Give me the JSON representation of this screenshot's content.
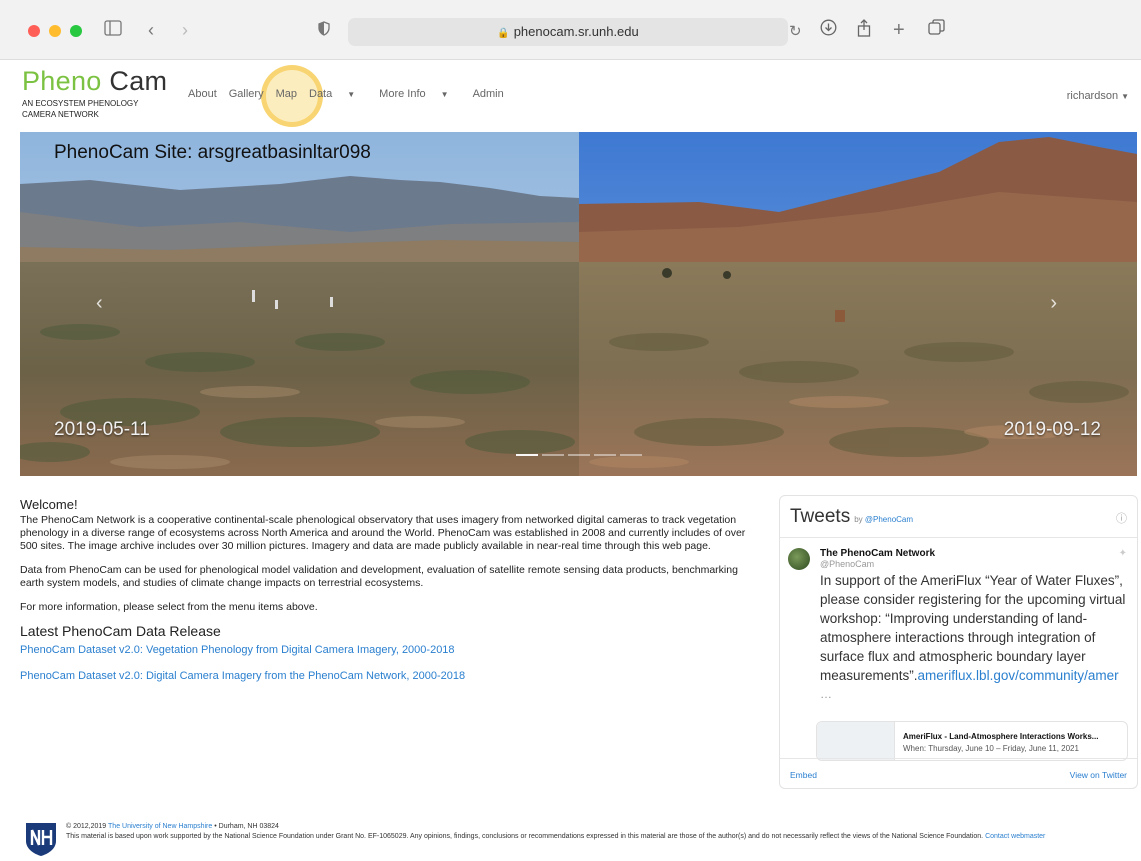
{
  "browser": {
    "url": "phenocam.sr.unh.edu"
  },
  "site": {
    "logo_pheno": "Pheno",
    "logo_cam": "Cam",
    "logo_subtitle": "AN ECOSYSTEM PHENOLOGY CAMERA NETWORK",
    "nav": {
      "about": "About",
      "gallery": "Gallery",
      "map": "Map",
      "data": "Data",
      "more_info": "More Info",
      "admin": "Admin"
    },
    "user": "richardson"
  },
  "hero": {
    "title": "PhenoCam Site: arsgreatbasinltar098",
    "date_left": "2019-05-11",
    "date_right": "2019-09-12",
    "indicator_count": 5,
    "active_indicator": 1
  },
  "welcome": {
    "heading": "Welcome!",
    "p1": "The PhenoCam Network is a cooperative continental-scale phenological observatory that uses imagery from networked digital cameras to track vegetation phenology in a diverse range of ecosystems across North America and around the World. PhenoCam was established in 2008 and currently includes of over 500 sites. The image archive includes over 30 million pictures. Imagery and data are made publicly available in near-real time through this web page.",
    "p2": "Data from PhenoCam can be used for phenological model validation and development, evaluation of satellite remote sensing data products, benchmarking earth system models, and studies of climate change impacts on terrestrial ecosystems.",
    "p3": "For more information, please select from the menu items above.",
    "release_heading": "Latest PhenoCam Data Release",
    "link1": "PhenoCam Dataset v2.0: Vegetation Phenology from Digital Camera Imagery, 2000-2018",
    "link2": "PhenoCam Dataset v2.0: Digital Camera Imagery from the PhenoCam Network, 2000-2018"
  },
  "tweets": {
    "title": "Tweets",
    "by": "by",
    "handle": "@PhenoCam",
    "author_name": "The PhenoCam Network",
    "author_handle": "@PhenoCam",
    "text": "In support of the AmeriFlux “Year of Water Fluxes”, please consider registering for the upcoming virtual workshop: “Improving understanding of land-atmosphere interactions through integration of surface flux and atmospheric boundary layer measurements”.",
    "link": "ameriflux.lbl.gov/community/amer",
    "ellipsis": "…",
    "card_title": "AmeriFlux - Land-Atmosphere Interactions Works...",
    "card_subtitle": "When: Thursday, June 10 – Friday, June 11, 2021",
    "embed": "Embed",
    "view_on_twitter": "View on Twitter"
  },
  "footer": {
    "copyright": "© 2012,2019",
    "university": "The University of New Hampshire",
    "location": "• Durham, NH 03824",
    "support": "This material is based upon work supported by the National Science Foundation under Grant No. EF-1065029. Any opinions, findings, conclusions or recommendations expressed in this material are those of the author(s) and do not necessarily reflect the views of the National Science Foundation.",
    "contact": "Contact webmaster"
  },
  "colors": {
    "logo_green": "#7cc242",
    "link_blue": "#2a7fcf",
    "highlight": "#f7cd5a"
  },
  "icons": {
    "sidebar": "sidebar-icon",
    "back": "chevron-left-icon",
    "forward": "chevron-right-icon",
    "shield": "shield-icon",
    "lock": "lock-icon",
    "reload": "reload-icon",
    "download": "download-icon",
    "share": "share-icon",
    "new_tab": "plus-icon",
    "tabs": "tabs-overview-icon"
  }
}
